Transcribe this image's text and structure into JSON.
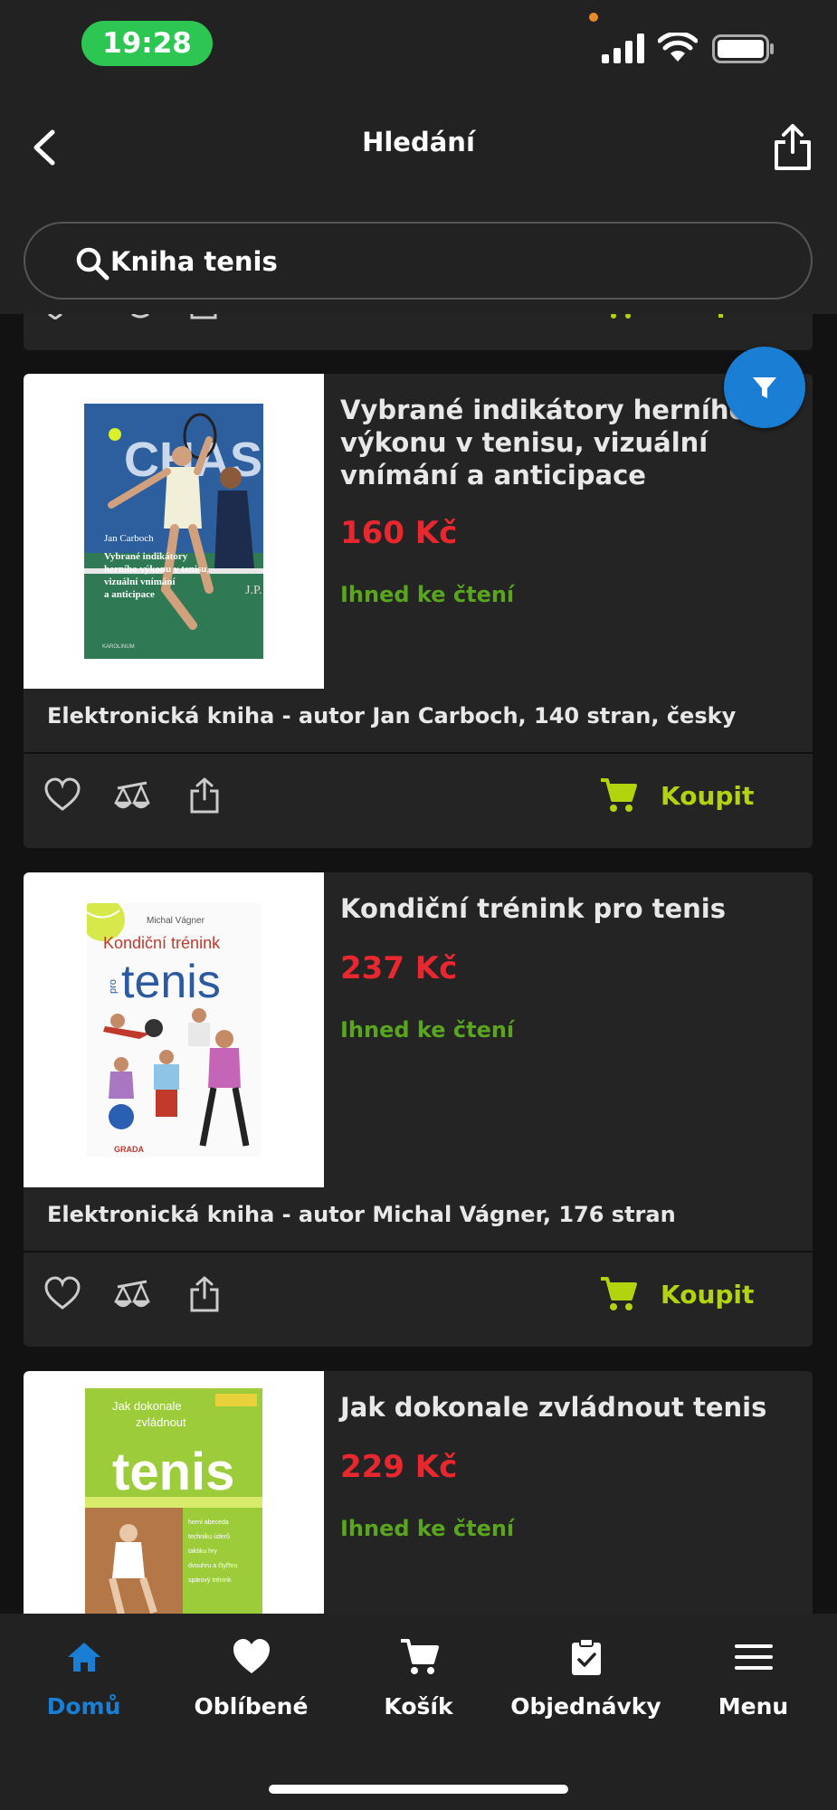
{
  "status_bar": {
    "time": "19:28"
  },
  "header": {
    "title": "Hledání"
  },
  "search": {
    "value": "Kniha tenis"
  },
  "colors": {
    "price": "#e8272f",
    "availability": "#5aa520",
    "buy": "#b2d40f",
    "accent": "#1a7fd4"
  },
  "products": [
    {
      "title": "Vybrané indikátory herního výkonu v tenisu, vizuální vnímání a anticipace",
      "price": "160 Kč",
      "availability": "Ihned ke čtení",
      "description": "Elektronická kniha - autor Jan Carboch, 140 stran, česky",
      "buy_label": "Koupit",
      "cover": {
        "author": "Jan Carboch",
        "title": "Vybrané indikátory herního výkonu v tenisu, vizuální vnímání a anticipace",
        "banner_text": "CHAS",
        "publisher": "KAROLINUM"
      }
    },
    {
      "title": "Kondiční trénink pro tenis",
      "price": "237 Kč",
      "availability": "Ihned ke čtení",
      "description": "Elektronická kniha - autor Michal Vágner, 176 stran",
      "buy_label": "Koupit",
      "cover": {
        "author": "Michal Vágner",
        "title_line1": "Kondiční trénink",
        "pro": "pro",
        "title_line2": "tenis",
        "publisher": "GRADA"
      }
    },
    {
      "title": "Jak dokonale zvládnout tenis",
      "price": "229 Kč",
      "availability": "Ihned ke čtení",
      "cover": {
        "title_line1": "Jak dokonale",
        "title_line2": "zvládnout",
        "big": "tenis",
        "list": [
          "herní abeceda",
          "techniku úderů",
          "taktiku hry",
          "dvouhru a čtyřhru",
          "spárový trénink"
        ]
      }
    }
  ],
  "tabbar": [
    {
      "label": "Domů",
      "icon": "home-icon",
      "active": true
    },
    {
      "label": "Oblíbené",
      "icon": "heart-icon"
    },
    {
      "label": "Košík",
      "icon": "cart-icon"
    },
    {
      "label": "Objednávky",
      "icon": "clipboard-icon"
    },
    {
      "label": "Menu",
      "icon": "hamburger-icon"
    }
  ]
}
